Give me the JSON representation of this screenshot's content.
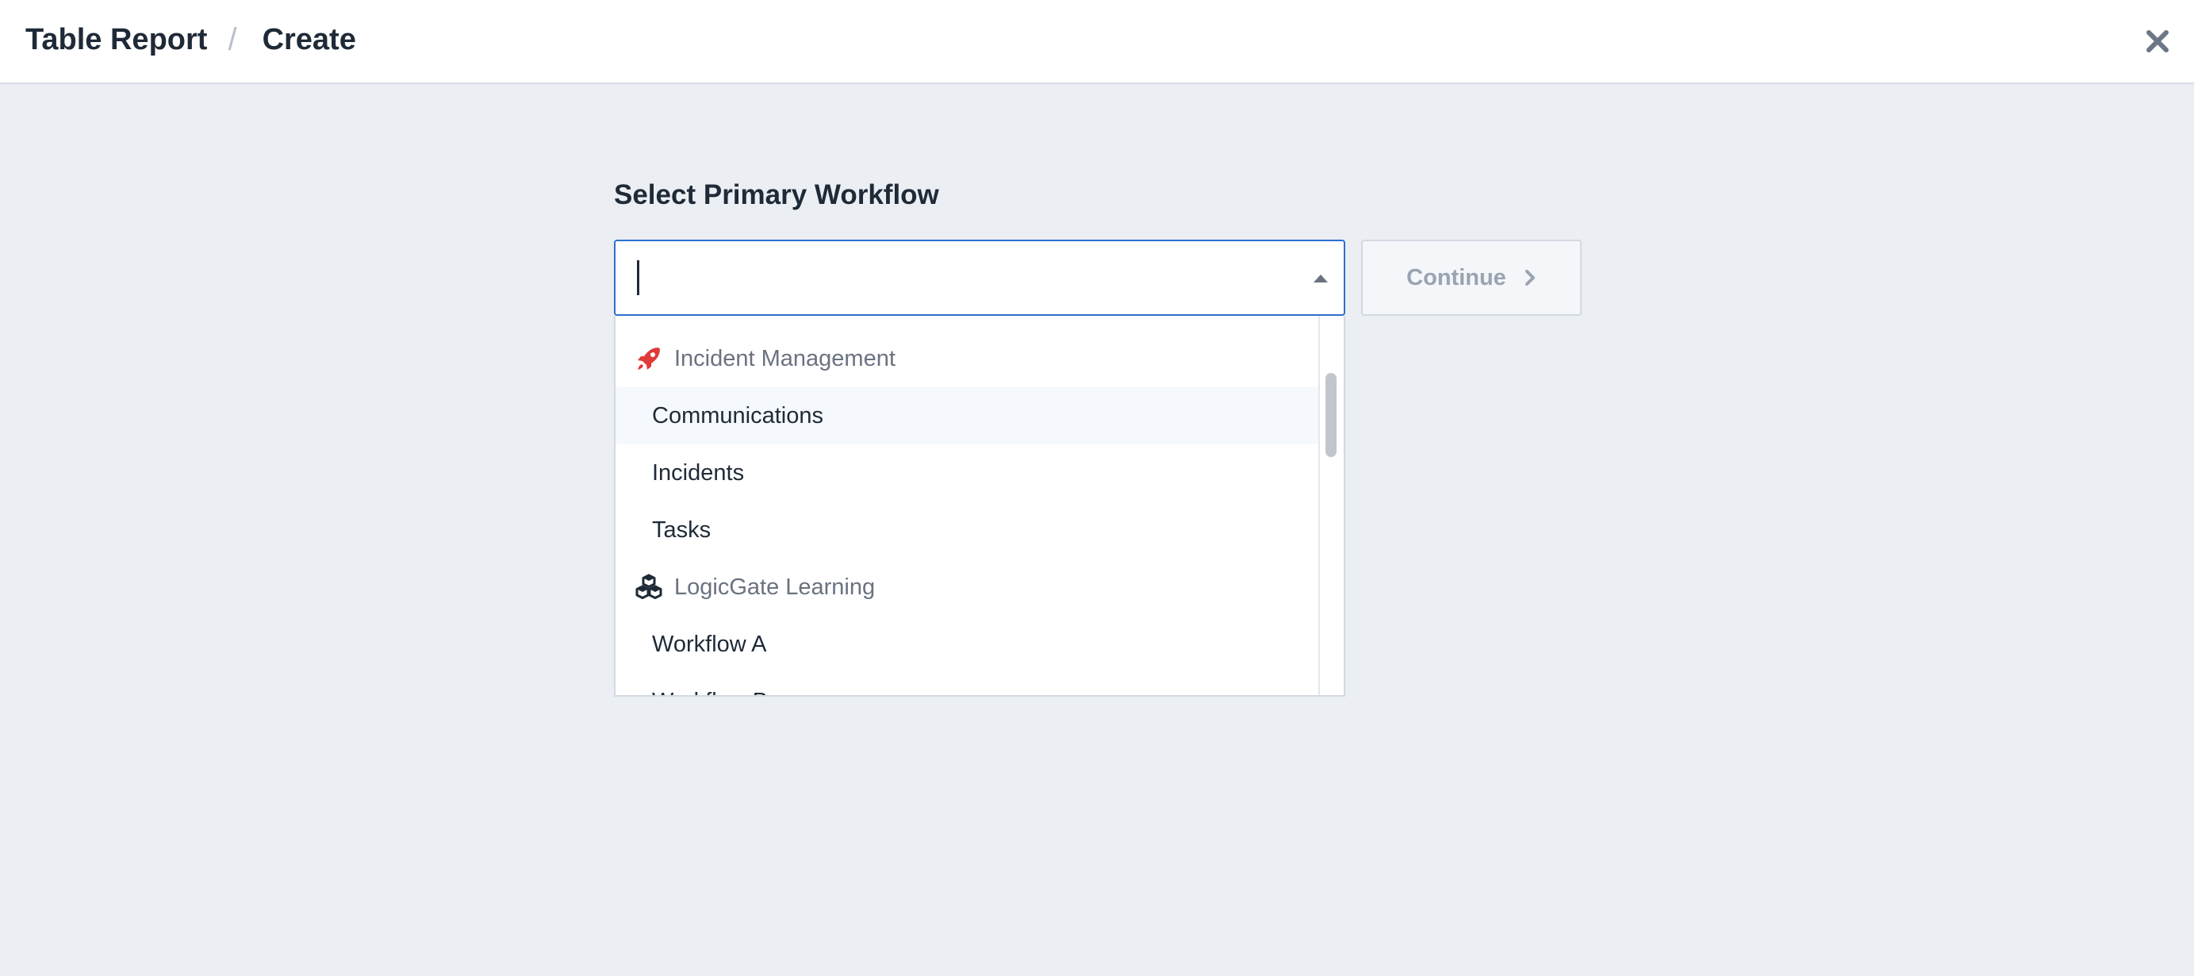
{
  "header": {
    "breadcrumb_root": "Table Report",
    "breadcrumb_separator": "/",
    "breadcrumb_current": "Create",
    "close_icon": "close-icon"
  },
  "form": {
    "title": "Select Primary Workflow",
    "search_value": "",
    "continue_label": "Continue"
  },
  "dropdown": {
    "groups": [
      {
        "label": "Incident Management",
        "icon": "rocket-icon",
        "icon_color": "#e03a3a",
        "items": [
          "Communications",
          "Incidents",
          "Tasks"
        ]
      },
      {
        "label": "LogicGate Learning",
        "icon": "cubes-icon",
        "icon_color": "#1f2a37",
        "items": [
          "Workflow A",
          "Workflow B"
        ]
      }
    ],
    "hovered_item": "Communications"
  },
  "colors": {
    "background": "#ebeef3",
    "focus_border": "#2f6fcf",
    "disabled_text": "#9aa3b1"
  }
}
